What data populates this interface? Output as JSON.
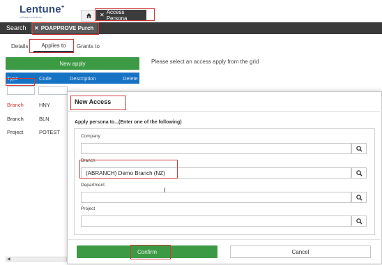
{
  "header": {
    "logo_text": "Lentune",
    "logo_sub": "software solutions",
    "tabs": [
      {
        "label": "Access Persona",
        "icon": "close-icon"
      }
    ]
  },
  "navbar": {
    "search_label": "Search",
    "active_tab": "POAPPROVE Purch"
  },
  "subtabs": [
    "Details",
    "Applies to",
    "Grants to"
  ],
  "left_panel": {
    "new_button": "New apply",
    "hint": "Please select an access apply from the grid",
    "grid": {
      "columns": [
        "Type",
        "Code",
        "Description",
        "Delete"
      ],
      "rows": [
        {
          "type": "Branch",
          "code": "HNY"
        },
        {
          "type": "Branch",
          "code": "BLN"
        },
        {
          "type": "Project",
          "code": "POTEST"
        }
      ]
    }
  },
  "modal": {
    "title": "New Access",
    "instruction": "Apply persona to...(Enter one of the following)",
    "fields": [
      {
        "label": "Company",
        "value": ""
      },
      {
        "label": "Branch",
        "value": "(ABRANCH) Demo Branch (NZ)"
      },
      {
        "label": "Department",
        "value": ""
      },
      {
        "label": "Project",
        "value": ""
      }
    ],
    "confirm_label": "Confirm",
    "cancel_label": "Cancel"
  },
  "colors": {
    "accent_green": "#3d9a44",
    "grid_header_blue": "#1673c4",
    "nav_dark": "#3a3a3a",
    "highlight_red": "#d03a3a"
  }
}
